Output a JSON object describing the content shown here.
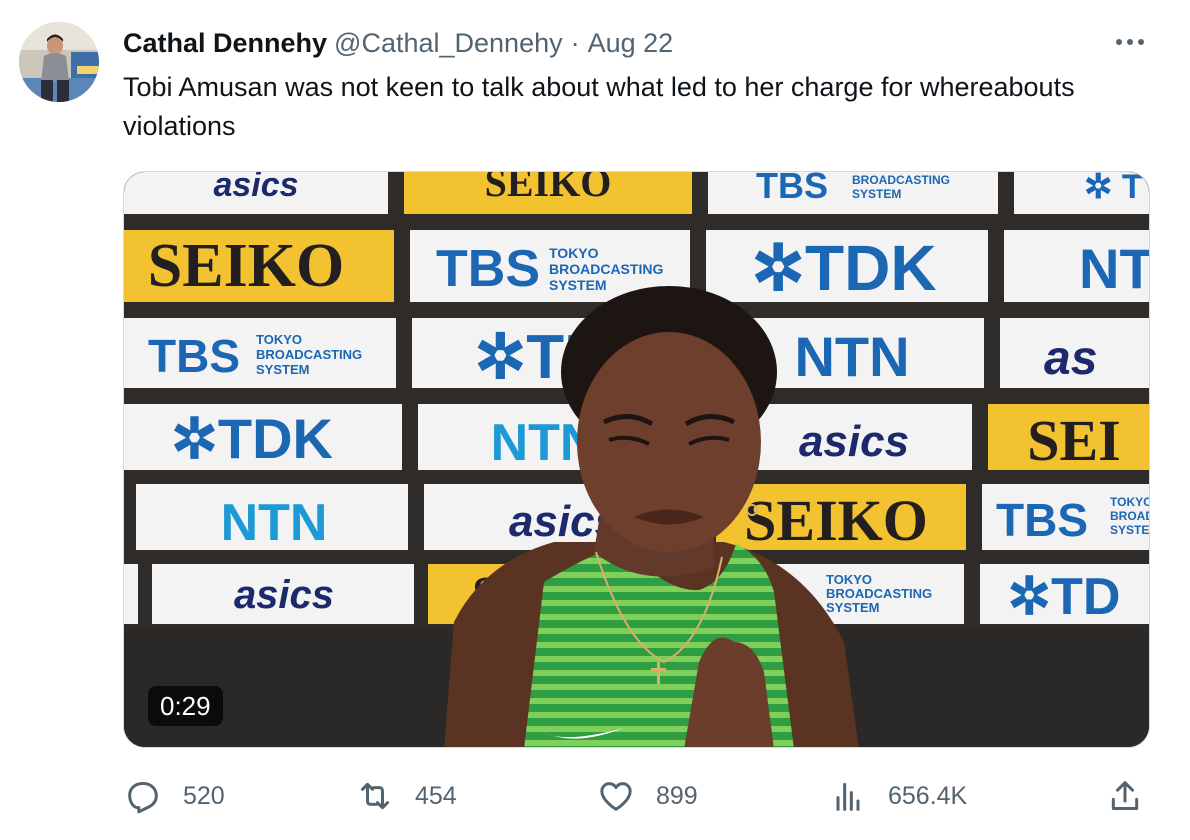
{
  "tweet": {
    "author": {
      "display_name": "Cathal Dennehy",
      "handle": "@Cathal_Dennehy"
    },
    "separator": "·",
    "date": "Aug 22",
    "text": "Tobi Amusan was not keen to talk about what led to her charge for whereabouts violations",
    "media": {
      "type": "video",
      "duration": "0:29",
      "sponsor_boards": [
        "asics",
        "SEIKO",
        "TBS",
        "TOKYO BROADCASTING SYSTEM",
        "TDK",
        "NTN"
      ]
    },
    "actions": {
      "reply_count": "520",
      "retweet_count": "454",
      "like_count": "899",
      "view_count": "656.4K"
    }
  },
  "icons": [
    "more-icon",
    "reply-icon",
    "retweet-icon",
    "like-icon",
    "views-icon",
    "share-icon"
  ],
  "colors": {
    "text_primary": "#0f1419",
    "text_secondary": "#536471",
    "seiko_yellow": "#f2c230",
    "board_blue": "#1b67b3"
  }
}
